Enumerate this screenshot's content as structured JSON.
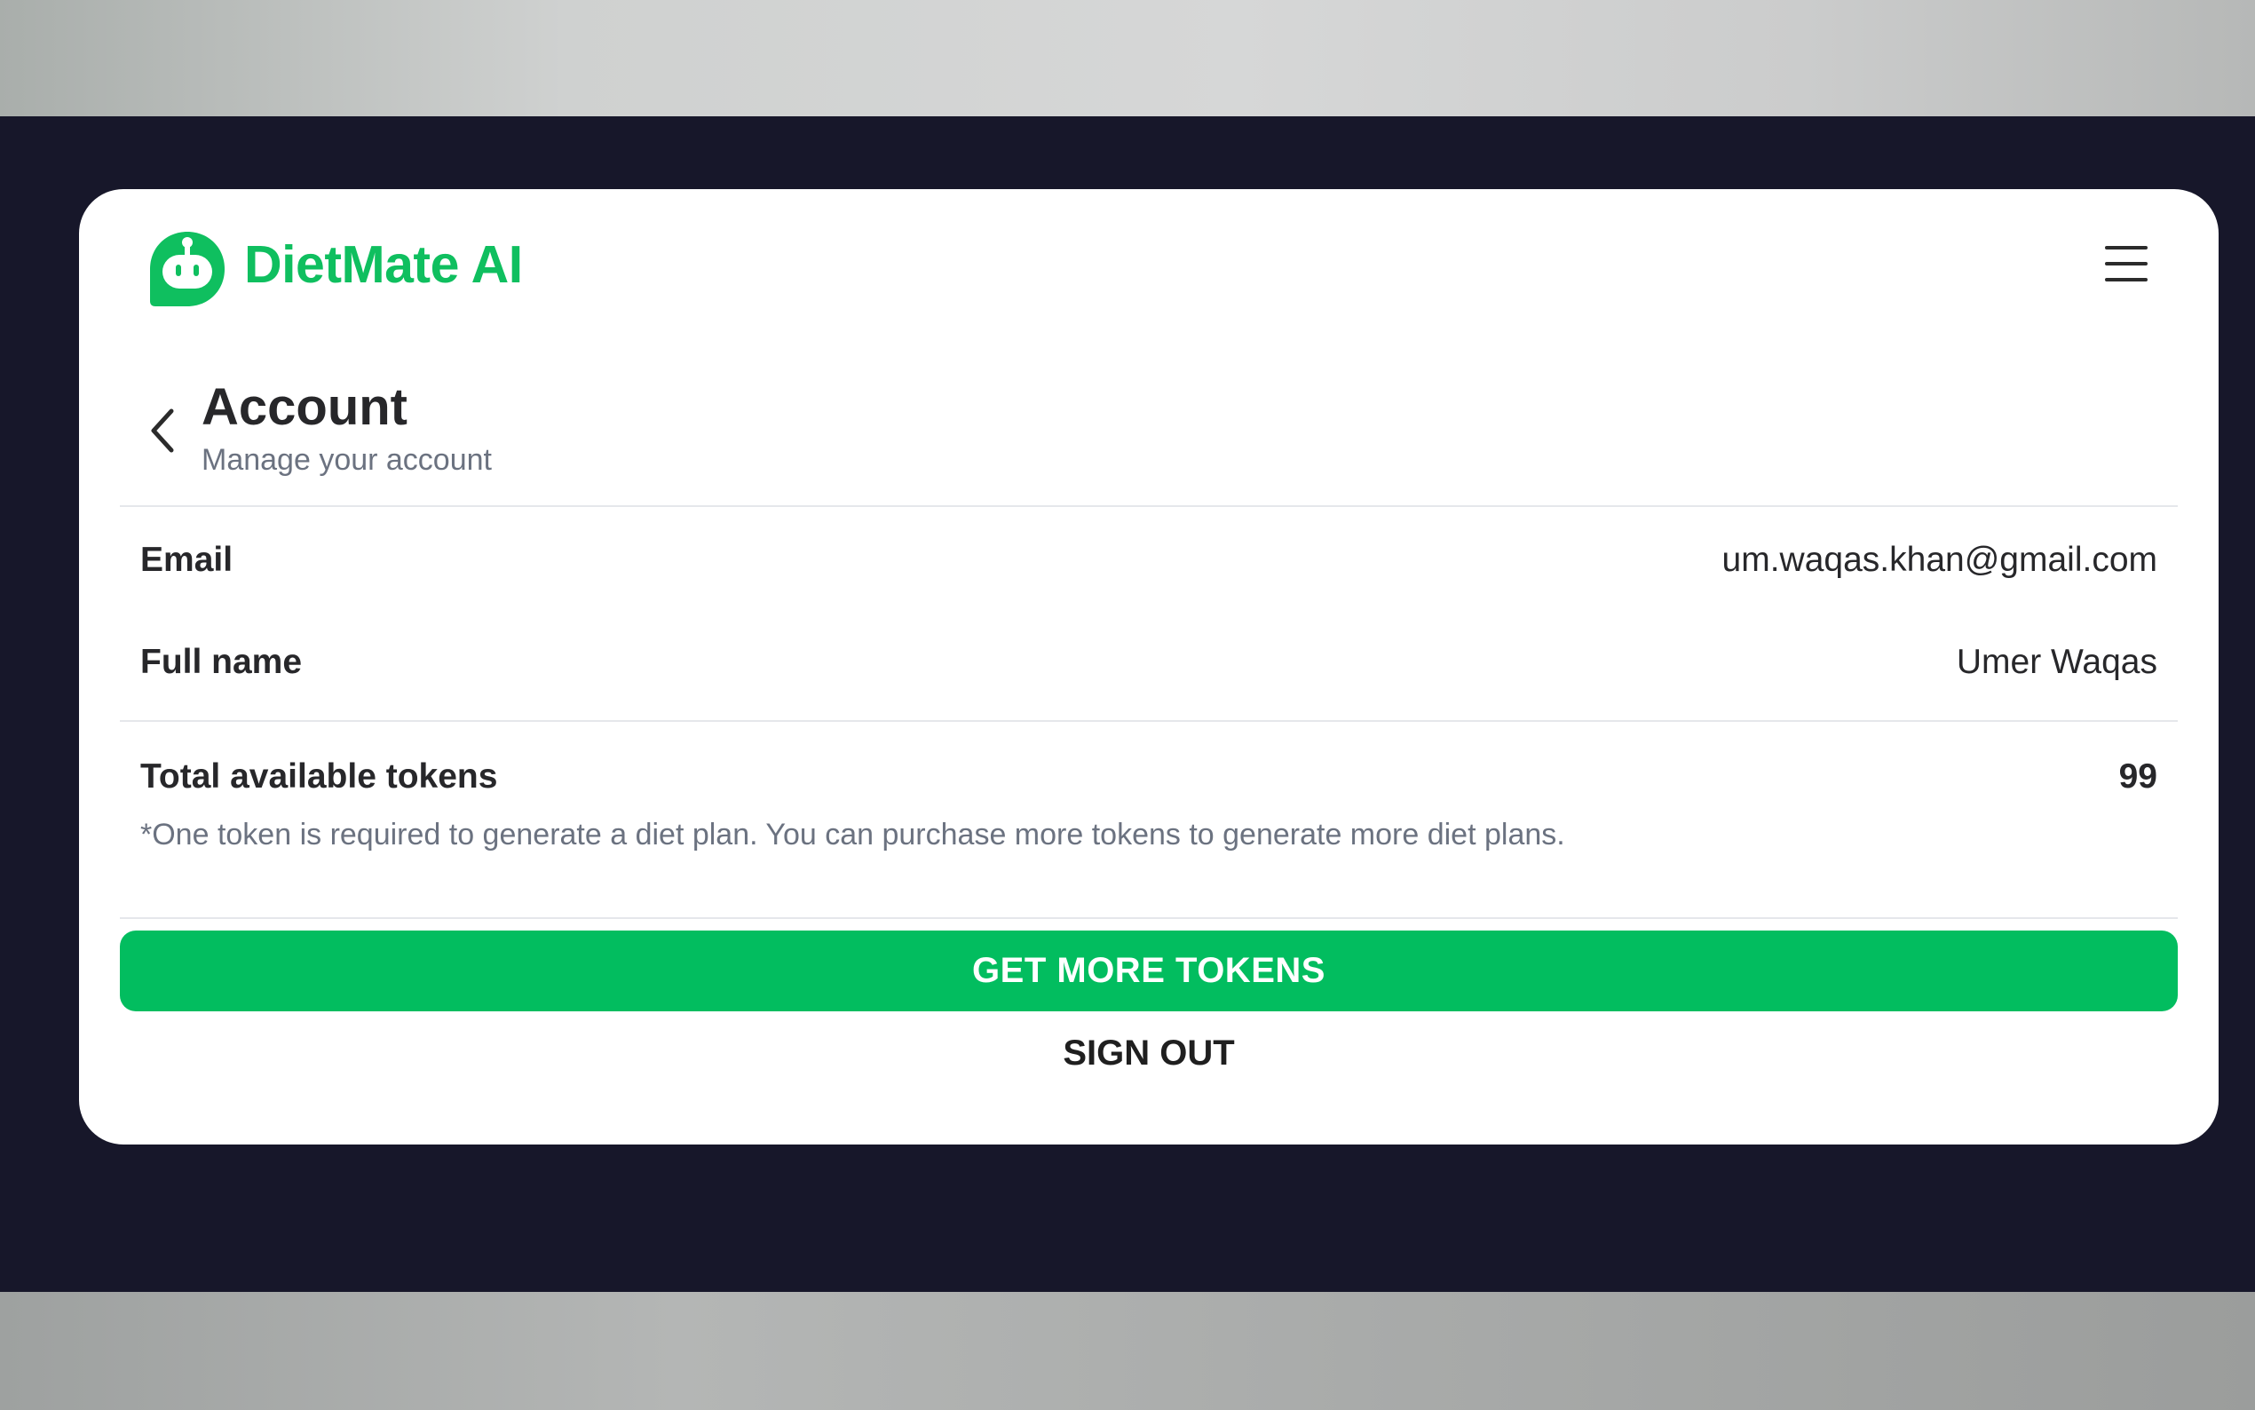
{
  "app": {
    "name": "DietMate AI",
    "brand_color": "#0fbf5f",
    "logo_icon": "robot-chat-bubble-icon"
  },
  "header": {
    "menu_icon": "hamburger-menu-icon"
  },
  "page": {
    "back_icon": "chevron-left-icon",
    "title": "Account",
    "subtitle": "Manage your account"
  },
  "profile": {
    "email_label": "Email",
    "email_value": "um.waqas.khan@gmail.com",
    "full_name_label": "Full name",
    "full_name_value": "Umer Waqas"
  },
  "tokens": {
    "label": "Total available tokens",
    "value": "99",
    "note": "*One token is required to generate a diet plan. You can purchase more tokens to generate more diet plans."
  },
  "actions": {
    "get_more_label": "GET MORE TOKENS",
    "get_more_color": "#02bd5f",
    "sign_out_label": "SIGN OUT"
  }
}
